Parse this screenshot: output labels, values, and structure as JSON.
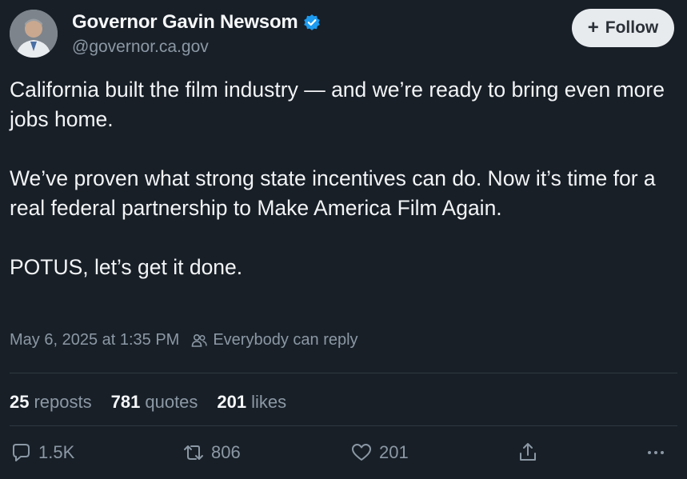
{
  "author": {
    "name": "Governor Gavin Newsom",
    "handle": "@governor.ca.gov",
    "verified_color": "#1d9bf0"
  },
  "follow_button": {
    "label": "Follow"
  },
  "tweet": {
    "paragraphs": [
      "California built the film industry — and we’re ready to bring even more jobs home.",
      "We’ve proven what strong state incentives can do. Now it’s time for a real federal partnership to Make America Film Again.",
      "POTUS, let’s get it done."
    ]
  },
  "meta": {
    "timestamp": "May 6, 2025 at 1:35 PM",
    "reply_setting": "Everybody can reply"
  },
  "stats": {
    "reposts_count": "25",
    "reposts_label": "reposts",
    "quotes_count": "781",
    "quotes_label": "quotes",
    "likes_count": "201",
    "likes_label": "likes"
  },
  "actions": {
    "replies": "1.5K",
    "reposts": "806",
    "likes": "201"
  },
  "icons": {
    "reply": "reply-icon",
    "repost": "repost-icon",
    "like": "heart-icon",
    "share": "share-icon",
    "more": "more-icon",
    "audience": "people-icon",
    "verified": "verified-badge-icon"
  },
  "colors": {
    "background": "#181f27",
    "primary_text": "#f2f4f6",
    "secondary_text": "#8b98a5",
    "follow_button_bg": "#e8ebee"
  }
}
